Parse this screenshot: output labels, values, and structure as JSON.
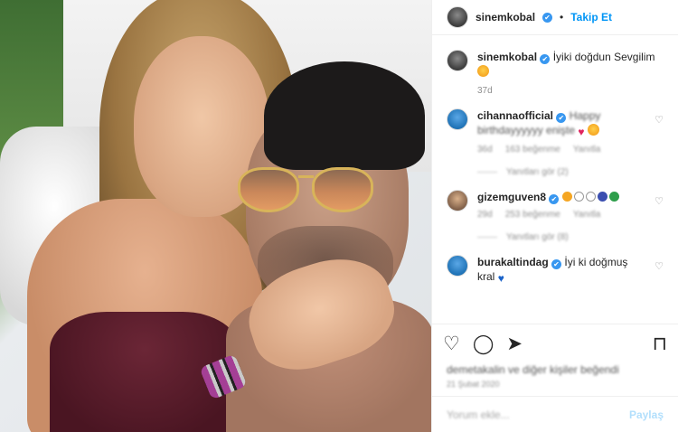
{
  "header": {
    "username": "sinemkobal",
    "verified_mark": "✔",
    "separator": "•",
    "follow_label": "Takip Et"
  },
  "caption": {
    "username": "sinemkobal",
    "text": "İyiki doğdun Sevgilim",
    "time": "37d"
  },
  "comments": [
    {
      "username": "cihannaofficial",
      "text": "Happy birthdayyyyyy enişte",
      "time": "36d",
      "likes": "163 beğenme",
      "reply": "Yanıtla",
      "view_replies": "Yanıtları gör (2)"
    },
    {
      "username": "gizemguven8",
      "text": "",
      "time": "29d",
      "likes": "253 beğenme",
      "reply": "Yanıtla",
      "view_replies": "Yanıtları gör (8)"
    },
    {
      "username": "burakaltindag",
      "text": "İyi ki doğmuş kral"
    }
  ],
  "footer": {
    "liked_by": "demetakalin ve diğer kişiler beğendi",
    "date": "21 Şubat 2020",
    "comment_placeholder": "Yorum ekle...",
    "post_label": "Paylaş"
  },
  "icons": {
    "heart": "heart-icon",
    "comment": "comment-icon",
    "share": "share-icon",
    "save": "bookmark-icon"
  },
  "colors": {
    "link_blue": "#0095f6",
    "verified_blue": "#3897f0",
    "muted": "#8e8e8e"
  }
}
